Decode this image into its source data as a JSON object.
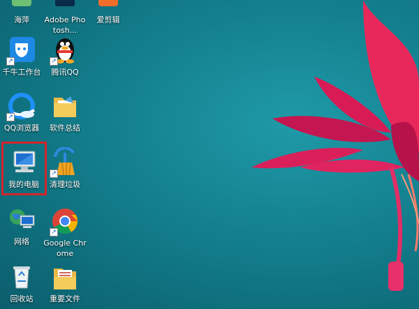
{
  "desktop": {
    "icons": [
      {
        "label": "海萍",
        "icon": "app-icon"
      },
      {
        "label": "Adobe Photosh...",
        "icon": "photoshop-icon"
      },
      {
        "label": "爱剪辑",
        "icon": "video-editor-icon"
      },
      {
        "label": "千牛工作台",
        "icon": "qianniu-icon"
      },
      {
        "label": "腾讯QQ",
        "icon": "qq-penguin-icon"
      },
      {
        "label": "QQ浏览器",
        "icon": "qq-browser-icon"
      },
      {
        "label": "软件总结",
        "icon": "folder-icon"
      },
      {
        "label": "我的电脑",
        "icon": "computer-icon"
      },
      {
        "label": "清理垃圾",
        "icon": "broom-icon"
      },
      {
        "label": "网络",
        "icon": "network-icon"
      },
      {
        "label": "Google Chrome",
        "icon": "chrome-icon"
      },
      {
        "label": "回收站",
        "icon": "recycle-bin-icon"
      },
      {
        "label": "重要文件",
        "icon": "document-folder-icon"
      }
    ],
    "highlight_color": "#d6242a"
  }
}
